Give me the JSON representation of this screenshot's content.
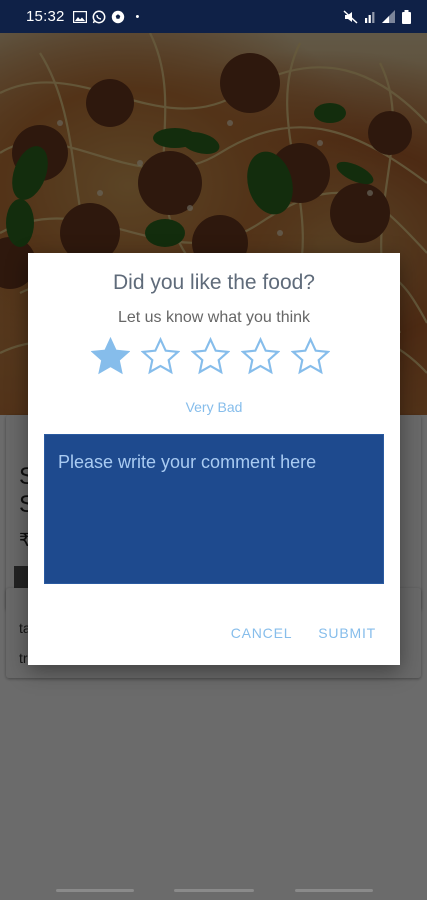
{
  "status_bar": {
    "time": "15:32",
    "dot": "•",
    "left_icons": [
      "image-icon",
      "whatsapp-icon",
      "soccer-icon"
    ],
    "right_icons": [
      "mute-icon",
      "wifi-icon",
      "signal-icon",
      "battery-icon"
    ]
  },
  "background": {
    "card_title_1": "S",
    "card_title_2": "S",
    "card_price": "₹",
    "card2_line1": "ta",
    "card2_line2": "tr"
  },
  "dialog": {
    "title": "Did you like the food?",
    "subtitle": "Let us know what you think",
    "rating": 1,
    "max_rating": 5,
    "rating_label": "Very Bad",
    "comment_placeholder": "Please write your comment here",
    "cancel_label": "CANCEL",
    "submit_label": "SUBMIT",
    "accent_color": "#86bdeb",
    "comment_bg_color": "#1e4a8e"
  }
}
